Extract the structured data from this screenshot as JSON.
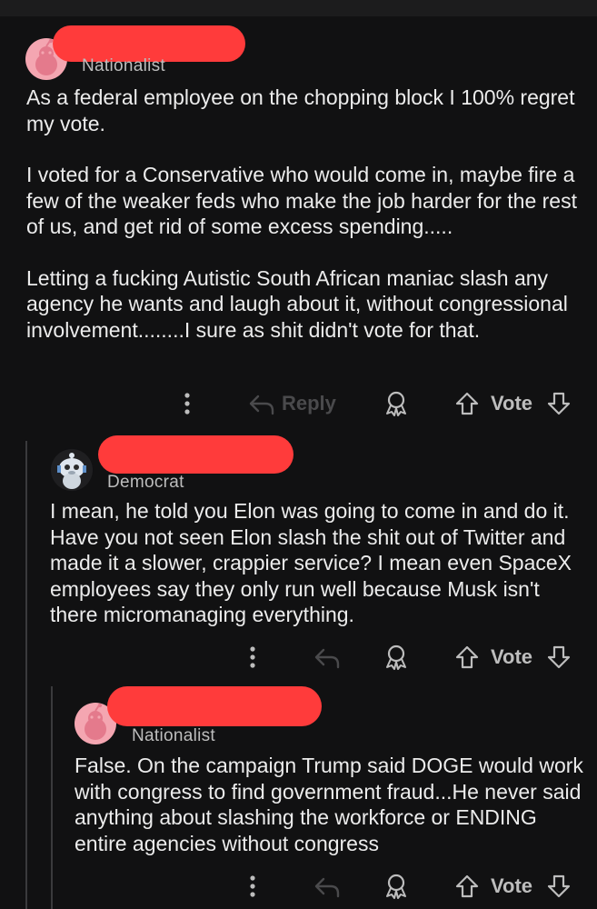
{
  "comments": [
    {
      "flair": "Nationalist",
      "paragraphs": [
        "As a federal employee on the chopping block I 100% regret my vote.",
        "I voted for a Conservative who would come in, maybe fire a few of the weaker feds who make the job harder for the rest of us, and get rid of some excess spending.....",
        "Letting a fucking Autistic South African maniac slash any agency he wants and laugh about it, without congressional involvement........I sure as shit didn't vote for that."
      ],
      "reply_label": "Reply",
      "vote_label": "Vote"
    },
    {
      "flair": "Democrat",
      "paragraphs": [
        "I mean, he told you Elon was going to come in and do it.  Have you not seen Elon slash the shit out of Twitter and made it a slower, crappier service?  I mean even SpaceX employees say they only run well because Musk isn't there micromanaging everything."
      ],
      "vote_label": "Vote"
    },
    {
      "flair": "Nationalist",
      "paragraphs": [
        "False.  On the campaign Trump said DOGE would work with congress to find government fraud...He never said anything about slashing the workforce or ENDING entire agencies without congress"
      ],
      "vote_label": "Vote"
    }
  ],
  "colors": {
    "background": "#111112",
    "redaction": "#ff3b3b",
    "avatar_pink": "#f4a6b1",
    "text": "#ececec",
    "muted": "#bdbdbd"
  },
  "icons": [
    "more-vertical-icon",
    "reply-arrow-icon",
    "award-icon",
    "upvote-icon",
    "downvote-icon",
    "snoo-avatar-icon"
  ]
}
